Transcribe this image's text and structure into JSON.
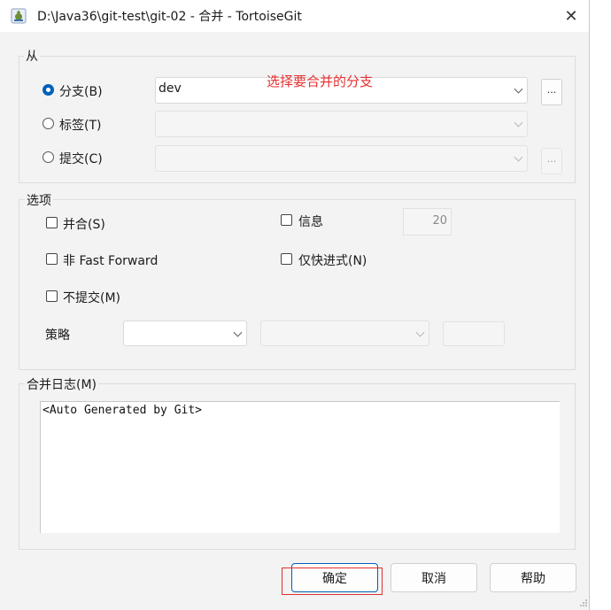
{
  "window": {
    "title": "D:\\Java36\\git-test\\git-02 - 合并 - TortoiseGit",
    "close_glyph": "✕"
  },
  "from_group": {
    "label": "从",
    "branch": {
      "label": "分支(B)",
      "value": "dev",
      "selected": true,
      "browse": "..."
    },
    "tag": {
      "label": "标签(T)",
      "value": ""
    },
    "commit": {
      "label": "提交(C)",
      "value": "",
      "browse": "..."
    }
  },
  "annotation": "选择要合并的分支",
  "options_group": {
    "label": "选项",
    "squash": "并合(S)",
    "no_ff": "非 Fast Forward",
    "no_commit": "不提交(M)",
    "message": "信息",
    "message_count": "20",
    "ff_only": "仅快进式(N)",
    "strategy_label": "策略"
  },
  "log_group": {
    "label": "合并日志(M)",
    "text": "<Auto Generated by Git>"
  },
  "buttons": {
    "ok": "确定",
    "cancel": "取消",
    "help": "帮助"
  },
  "colors": {
    "accent": "#005fb8",
    "annotation": "#e53030",
    "highlight_box": "#e03030"
  }
}
